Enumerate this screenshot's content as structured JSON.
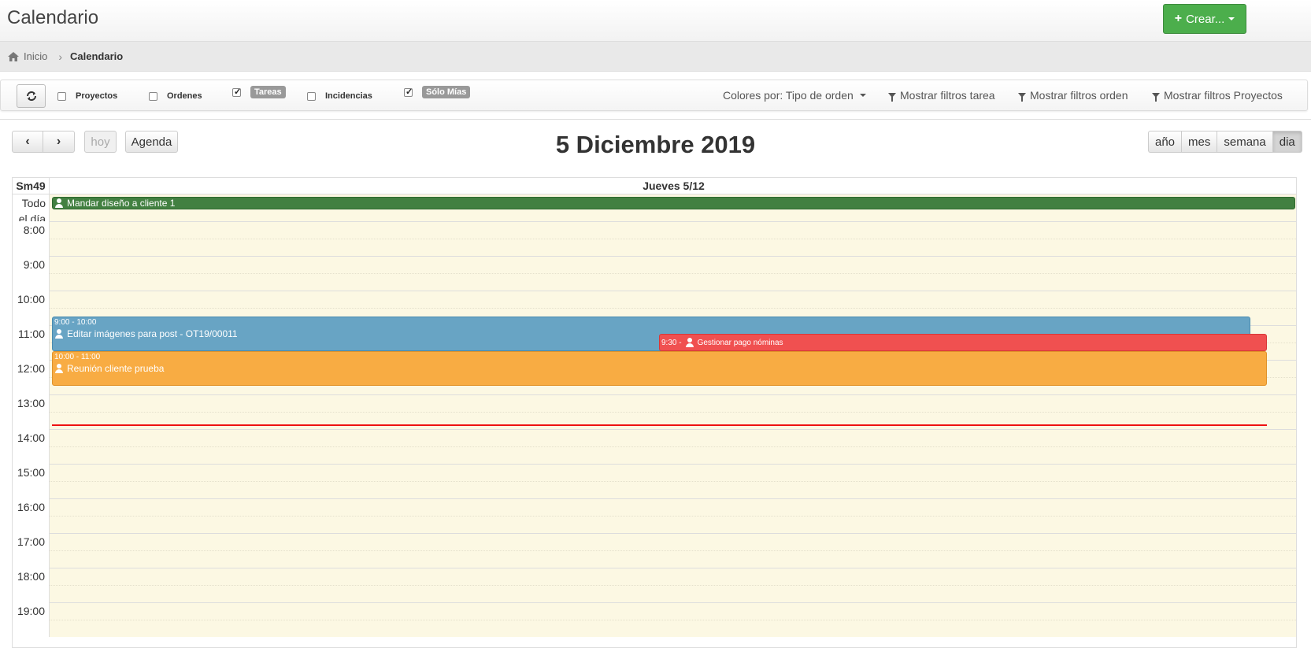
{
  "header": {
    "title": "Calendario",
    "create_label": "Crear..."
  },
  "breadcrumb": {
    "home": "Inicio",
    "current": "Calendario"
  },
  "toolbar": {
    "filters": [
      {
        "label": "Proyectos",
        "checked": false
      },
      {
        "label": "Ordenes",
        "checked": false
      },
      {
        "label": "Tareas",
        "checked": true
      },
      {
        "label": "Incidencias",
        "checked": false
      },
      {
        "label": "Sólo Mías",
        "checked": true
      }
    ],
    "colors_by": "Colores por: Tipo de orden",
    "show_task_filters": "Mostrar filtros tarea",
    "show_order_filters": "Mostrar filtros orden",
    "show_project_filters": "Mostrar filtros Proyectos"
  },
  "calendar": {
    "prev": "‹",
    "next": "›",
    "today": "hoy",
    "agenda": "Agenda",
    "title": "5 Diciembre 2019",
    "views": [
      "año",
      "mes",
      "semana",
      "dia"
    ],
    "active_view": "dia",
    "week": "Sm49",
    "day_label": "Jueves 5/12",
    "allday_label_1": "Todo",
    "allday_label_2": "el día",
    "allday_event": "Mandar diseño a cliente 1",
    "hours": [
      "8:00",
      "9:00",
      "10:00",
      "11:00",
      "12:00",
      "13:00",
      "14:00",
      "15:00",
      "16:00",
      "17:00",
      "18:00",
      "19:00"
    ],
    "events": [
      {
        "time": "9:00 - 10:00",
        "title": "Editar imágenes para post - OT19/00011",
        "color": "#68a4c4"
      },
      {
        "time": "9:30 -",
        "title": "Gestionar pago nóminas",
        "color": "#f05050"
      },
      {
        "time": "10:00 - 11:00",
        "title": "Reunión cliente prueba",
        "color": "#f8ac43"
      }
    ]
  },
  "colors": {
    "create": "#4cae4c",
    "allday_event": "#428041",
    "now_line": "#e11111",
    "slot_bg": "#fcf8e3"
  }
}
